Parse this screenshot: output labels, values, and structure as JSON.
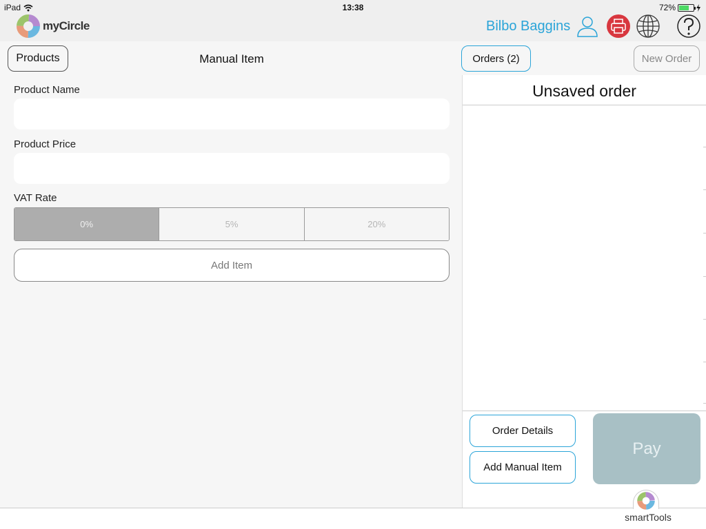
{
  "status_bar": {
    "device": "iPad",
    "time": "13:38",
    "battery": "72%",
    "battery_level": 0.72
  },
  "header": {
    "brand": "myCircle",
    "user_name": "Bilbo Baggins",
    "colors": {
      "accent": "#2aa4d8",
      "printer": "#d8373f"
    },
    "icons": [
      "user-icon",
      "printer-icon",
      "globe-icon",
      "help-icon"
    ]
  },
  "nav": {
    "products_label": "Products",
    "title": "Manual Item",
    "orders_label": "Orders (2)",
    "new_order_label": "New Order"
  },
  "form": {
    "product_name_label": "Product Name",
    "product_name_value": "",
    "product_price_label": "Product Price",
    "product_price_value": "",
    "vat_label": "VAT Rate",
    "vat_options": [
      "0%",
      "5%",
      "20%"
    ],
    "vat_selected": "0%",
    "add_item_label": "Add Item"
  },
  "order": {
    "title": "Unsaved order",
    "order_details_label": "Order Details",
    "add_manual_item_label": "Add Manual Item",
    "pay_label": "Pay"
  },
  "footer": {
    "smarttools_label": "smartTools"
  }
}
